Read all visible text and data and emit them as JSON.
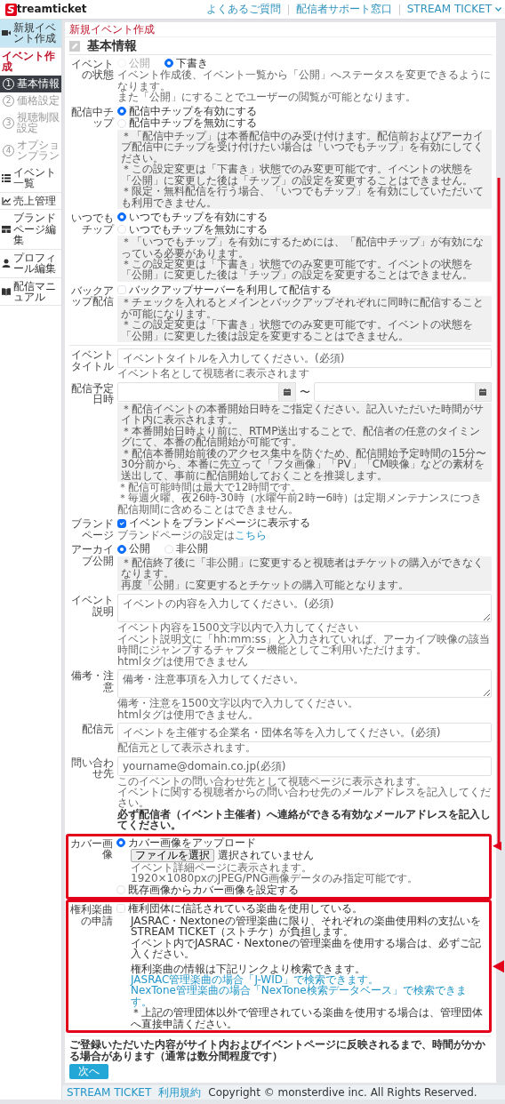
{
  "header": {
    "logo_mark": "S",
    "logo_text": "treamticket",
    "links": [
      {
        "label": "よくあるご質問",
        "dropdown": false
      },
      {
        "label": "配信者サポート窓口",
        "dropdown": false
      },
      {
        "label": "STREAM TICKET",
        "dropdown": true
      }
    ]
  },
  "sidebar": {
    "items": [
      {
        "kind": "nav",
        "label": "新規イベント作成",
        "selected": true
      },
      {
        "kind": "heading",
        "label": "イベント作成"
      },
      {
        "kind": "step",
        "number": "1",
        "label": "基本情報",
        "selected": true
      },
      {
        "kind": "step",
        "number": "2",
        "label": "価格設定",
        "selected": false
      },
      {
        "kind": "step",
        "number": "3",
        "label": "視聴制限設定",
        "selected": false
      },
      {
        "kind": "step",
        "number": "4",
        "label": "オプションプラン",
        "selected": false
      },
      {
        "kind": "nav",
        "label": "イベント一覧",
        "selected": false
      },
      {
        "kind": "nav",
        "label": "売上管理",
        "selected": false
      },
      {
        "kind": "nav",
        "label": "ブランドページ編集",
        "selected": false
      },
      {
        "kind": "nav",
        "label": "プロフィール編集",
        "selected": false
      },
      {
        "kind": "nav",
        "label": "配信マニュアル",
        "selected": false
      }
    ]
  },
  "main": {
    "title": "新規イベント作成",
    "section_title": "基本情報",
    "fields": [
      {
        "kind": "radio",
        "label": "イベントの状態",
        "inline": true,
        "options": [
          {
            "label": "公開",
            "selected": false,
            "disabled": true
          },
          {
            "label": "下書き",
            "selected": true,
            "disabled": false
          }
        ],
        "help": [
          "イベント作成後、イベント一覧から「公開」へステータスを変更できるようになります。",
          "また「公開」にすることでユーザーの閲覧が可能となります。"
        ]
      },
      {
        "kind": "radio",
        "label": "配信中チップ",
        "inline": false,
        "options": [
          {
            "label": "配信中チップを有効にする",
            "selected": true
          },
          {
            "label": "配信中チップを無効にする",
            "selected": false
          }
        ],
        "notes": [
          "＊「配信中チップ」は本番配信中のみ受け付けます。配信前およびアーカイブ配信中にチップを受け付けたい場合は「いつでもチップ」を有効にしてください。",
          "＊この設定変更は「下書き」状態でのみ変更可能です。イベントの状態を「公開」に変更した後は「チップ」の設定を変更することはできません。",
          "＊限定・無料配信を行う場合、「いつでもチップ」を有効にしていただいても利用できません。"
        ]
      },
      {
        "kind": "radio",
        "label": "いつでもチップ",
        "inline": false,
        "options": [
          {
            "label": "いつでもチップを有効にする",
            "selected": true
          },
          {
            "label": "いつでもチップを無効にする",
            "selected": false
          }
        ],
        "notes": [
          "＊「いつでもチップ」を有効にするためには、「配信中チップ」が有効になっている必要があります。",
          "＊この設定変更は「下書き」状態でのみ変更可能です。イベントの状態を「公開」に変更した後は「チップ」の設定を変更することはできません。"
        ]
      },
      {
        "kind": "checkbox",
        "label": "バックアップ配信",
        "options": [
          {
            "label": "バックアップサーバーを利用して配信する",
            "checked": false
          }
        ],
        "notes": [
          "＊チェックを入れるとメインとバックアップそれぞれに同時に配信することが可能になります。",
          "＊この設定変更は「下書き」状態でのみ変更可能です。イベントの状態を「公開」に変更した後は設定を変更することはできません。"
        ]
      },
      {
        "kind": "divider"
      },
      {
        "kind": "text",
        "label": "イベントタイトル",
        "placeholder": "イベントタイトルを入力してください。(必須)",
        "help": [
          "イベント名として視聴者に表示されます"
        ]
      },
      {
        "kind": "daterange",
        "label": "配信予定日時",
        "separator": "〜",
        "notes": [
          "＊配信イベントの本番開始日時をご指定ください。記入いただいた時間がサイト内に表示されます。",
          "＊本番開始日時より前に、RTMP送出することで、配信者の任意のタイミングにて、本番の配信開始が可能です。",
          "＊配信本番開始前後のアクセス集中を防ぐため、配信開始予定時間の15分〜30分前から、本番に先立って「フタ画像」「PV」「CM映像」などの素材を送出して、事前に配信開始しておくことを推奨します。"
        ],
        "help": [
          "＊配信可能時間は最大で12時間です。",
          "＊毎週火曜、夜26時-30時（水曜午前2時ー6時）は定期メンテナンスにつき配信期間に含めることはできません。"
        ]
      },
      {
        "kind": "checkbox",
        "label": "ブランドページ",
        "options": [
          {
            "label": "イベントをブランドページに表示する",
            "checked": true
          }
        ],
        "link_prefix": "ブランドページの設定は",
        "link": "こちら"
      },
      {
        "kind": "radio",
        "label": "アーカイブ公開",
        "inline": true,
        "options": [
          {
            "label": "公開",
            "selected": true
          },
          {
            "label": "非公開",
            "selected": false
          }
        ],
        "notes": [
          "＊配信終了後に「非公開」に変更すると視聴者はチケットの購入ができなくなります。",
          "再度「公開」に変更するとチケットの購入可能となります。"
        ]
      },
      {
        "kind": "textarea",
        "label": "イベント説明",
        "placeholder": "イベントの内容を入力してください。(必須)",
        "help": [
          "イベント内容を1500文字以内で入力してください",
          "イベント説明文に「hh:mm:ss」と入力されていれば、アーカイブ映像の該当時間にジャンプするチャプター機能としてご利用いただけます。",
          "htmlタグは使用できません"
        ]
      },
      {
        "kind": "textarea",
        "label": "備考・注意",
        "placeholder": "備考・注意事項を入力してください。",
        "help": [
          "備考・注意を1500文字以内で入力してください。",
          "htmlタグは使用できません。"
        ]
      },
      {
        "kind": "text",
        "label": "配信元",
        "placeholder": "イベントを主催する企業名・団体名等を入力してください。(必須)",
        "help": [
          "配信元として表示されます。"
        ]
      },
      {
        "kind": "text",
        "label": "問い合わせ先",
        "placeholder": "yourname@domain.co.jp(必須)",
        "help": [
          "このイベントの問い合わせ先として視聴ページに表示されます。",
          "イベントに関する視聴者からの問い合わせ先のメールアドレスを記入してください。"
        ],
        "help_strong": "必ず配信者（イベント主催者）へ連絡ができる有効なメールアドレスを記入してください。"
      },
      {
        "kind": "cover",
        "label": "カバー画像",
        "highlighted": true,
        "upload_option": {
          "label": "カバー画像をアップロード",
          "selected": true
        },
        "file_button": "ファイルを選択",
        "file_status": "選択されていません",
        "help": [
          "イベント詳細ページに表示されます。",
          "1920×1080pxのJPEG/PNG画像データのみ指定可能です。"
        ],
        "existing_option": {
          "label": "既存画像からカバー画像を設定する",
          "selected": false
        }
      },
      {
        "kind": "rights",
        "label": "権利楽曲の申請",
        "highlighted": true,
        "options": [
          {
            "label": "権利団体に信託されている楽曲を使用している。",
            "checked": false
          }
        ],
        "paragraphs": [
          [
            {
              "text": "JASRAC・Nextoneの管理楽曲に限り、それぞれの楽曲使用料の支払いを STREAM TICKET（ストチケ）が負担します。",
              "link": false
            },
            {
              "text": "イベント内でJASRAC・Nextoneの管理楽曲を使用する場合は、必ずご記入ください。",
              "link": false
            }
          ],
          [
            {
              "text": "権利楽曲の情報は下記リンクより検索できます。",
              "link": false
            },
            {
              "text": "JASRAC管理楽曲の場合「J-WID」で検索できます。",
              "link": true
            },
            {
              "text": "NexTone管理楽曲の場合「NexTone検索データベース」で検索できます。",
              "link": true
            },
            {
              "text": "＊上記の管理団体以外で管理されている楽曲を使用する場合は、管理団体へ直接申請ください。",
              "link": false
            }
          ]
        ]
      }
    ],
    "notice": "ご登録いただいた内容がサイト内およびイベントページに反映されるまで、時間がかかる場合があります（通常は数分間程度です）",
    "submit": "次へ"
  },
  "footer": {
    "links": [
      "STREAM TICKET",
      "利用規約"
    ],
    "copyright": "Copyright © monsterdive inc. All Rights Reserved."
  }
}
